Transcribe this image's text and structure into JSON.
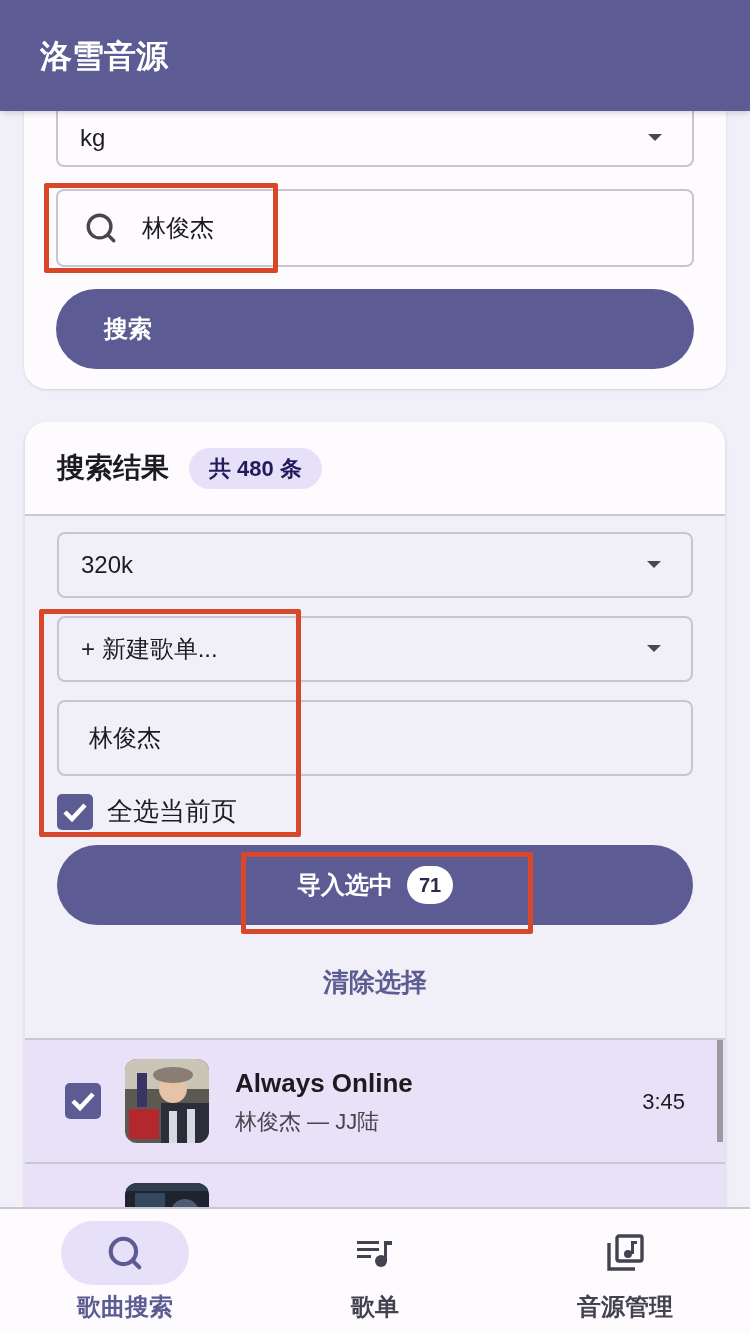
{
  "app_bar": {
    "title": "洛雪音源"
  },
  "search_card": {
    "source_select": {
      "value": "kg"
    },
    "search_field": {
      "value": "林俊杰",
      "highlighted": true
    },
    "search_button": "搜索"
  },
  "results_card": {
    "title": "搜索结果",
    "count_badge": "共 480 条",
    "quality_select": {
      "value": "320k"
    },
    "import_group": {
      "highlighted": true,
      "playlist_select": {
        "value": "+ 新建歌单..."
      },
      "playlist_name_field": {
        "value": "林俊杰"
      },
      "select_all": {
        "label": "全选当前页",
        "checked": true
      }
    },
    "import_button": {
      "label": "导入选中",
      "count": "71",
      "highlighted": true
    },
    "clear_link": "清除选择",
    "songs": [
      {
        "title": "Always Online",
        "artist_album": "林俊杰 — JJ陆",
        "duration": "3:45",
        "selected": true
      },
      {
        "selected": true,
        "kind": "picture"
      }
    ]
  },
  "bottom_nav": [
    {
      "label": "歌曲搜索",
      "kind": "search",
      "selected": true
    },
    {
      "label": "歌单",
      "kind": "playlist",
      "selected": false
    },
    {
      "label": "音源管理",
      "kind": "library",
      "selected": false
    }
  ]
}
